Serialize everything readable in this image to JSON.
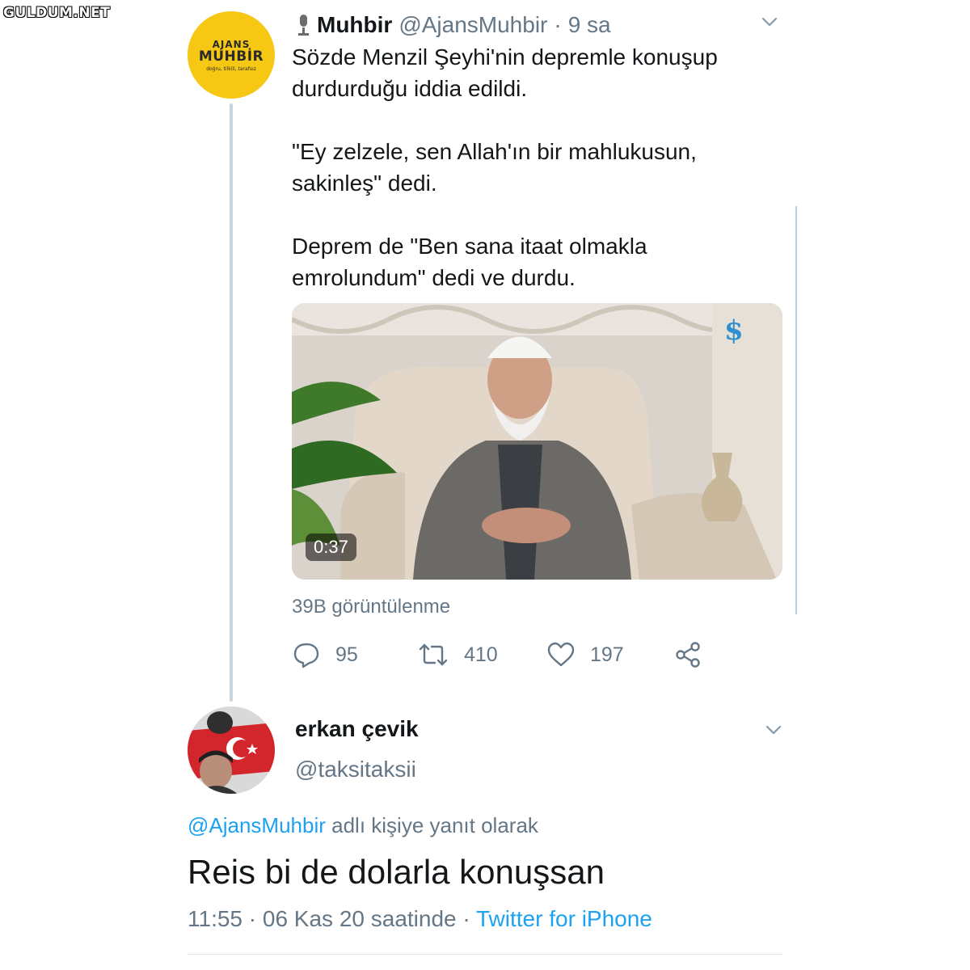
{
  "watermark": "GULDUM.NET",
  "tweet": {
    "avatar_text": {
      "line1": "AJANS",
      "line2": "MUHBİR",
      "line3": "doğru, tilkili, tarafsız"
    },
    "name": "Muhbir",
    "handle": "@AjansMuhbir",
    "separator": "·",
    "time": "9 sa",
    "paragraphs": [
      "Sözde Menzil Şeyhi'nin depremle konuşup durdurduğu iddia edildi.",
      "\"Ey zelzele, sen Allah'ın bir mahlukusun, sakinleş\" dedi.",
      "Deprem de \"Ben sana itaat olmakla emrolundum\" dedi ve durdu."
    ],
    "video": {
      "duration": "0:37"
    },
    "views": "39B görüntülenme",
    "actions": {
      "replies": "95",
      "retweets": "410",
      "likes": "197"
    }
  },
  "reply": {
    "name": "erkan çevik",
    "handle": "@taksitaksii",
    "replying_mention": "@AjansMuhbir",
    "replying_suffix": " adlı kişiye yanıt olarak",
    "text": "Reis bi de dolarla konuşsan",
    "timestamp": "11:55 · 06 Kas 20 saatinde",
    "meta_separator": " · ",
    "source": "Twitter for iPhone"
  },
  "colors": {
    "accent": "#1da1f2",
    "secondary_text": "#657786",
    "avatar_yellow": "#f6c713"
  }
}
